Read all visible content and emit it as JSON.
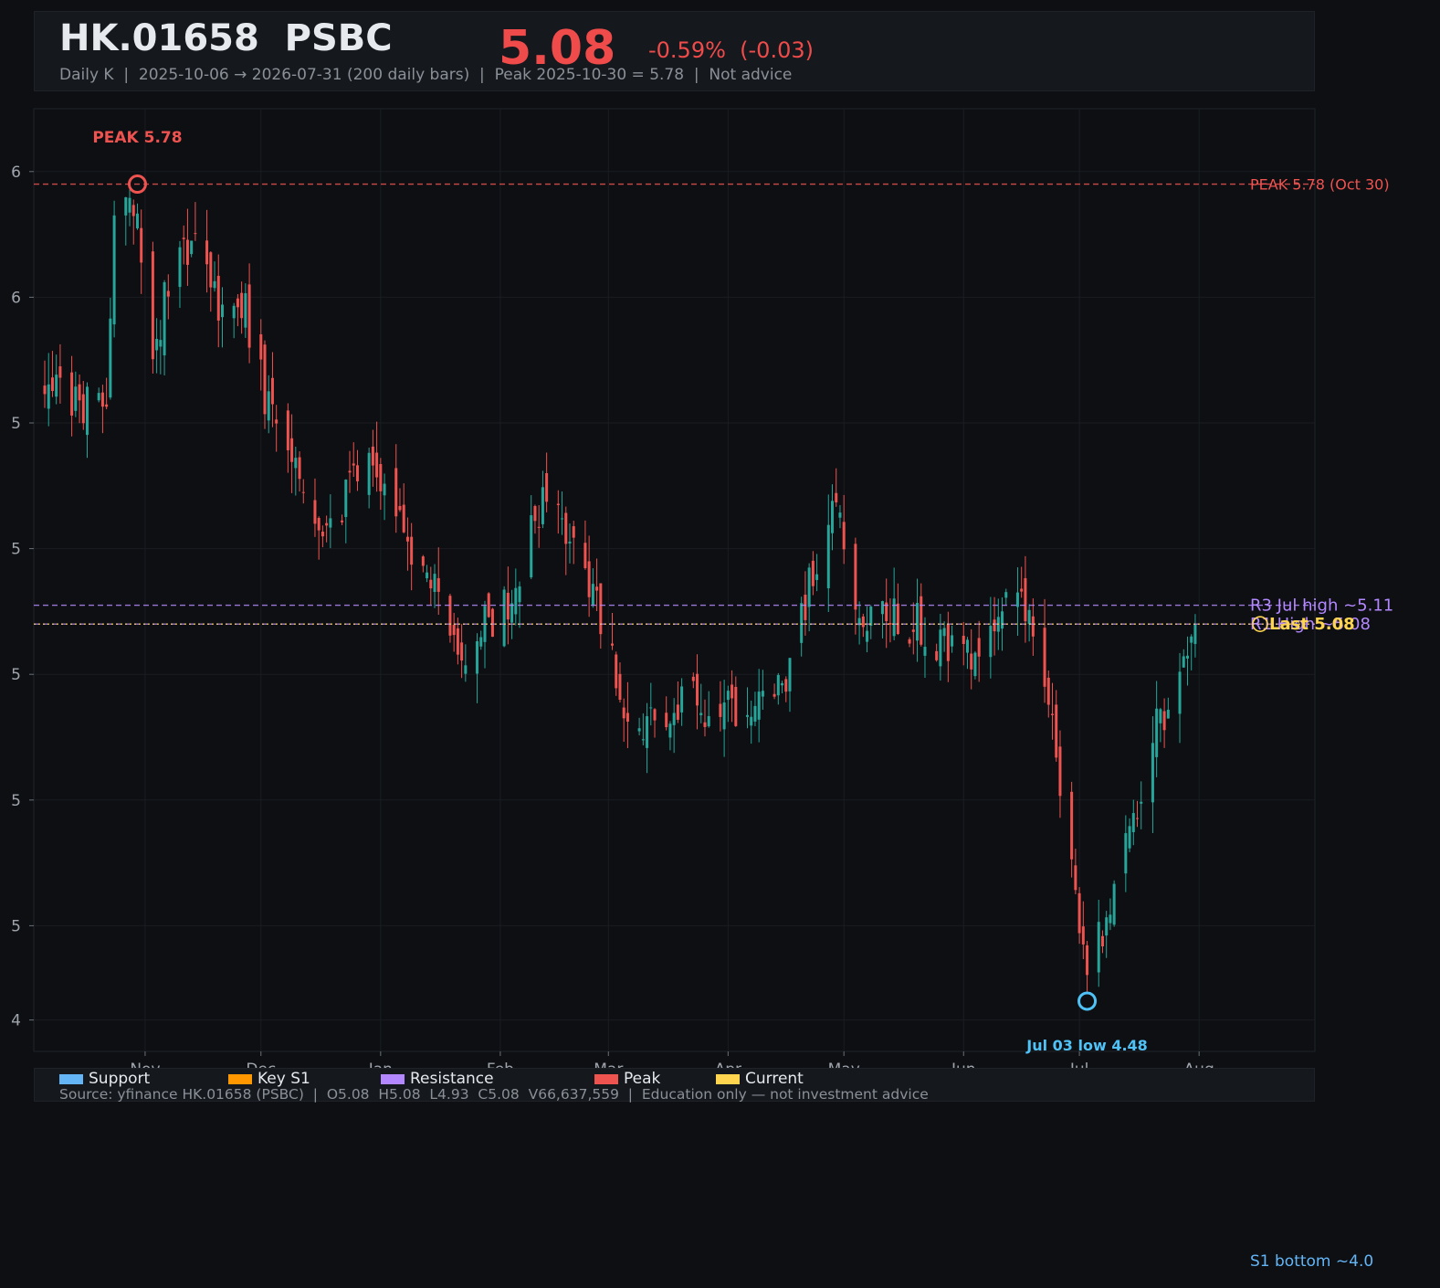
{
  "header": {
    "ticker": "HK.01658  PSBC",
    "price": "5.08",
    "change": "-0.59%  (-0.03)",
    "subtitle": "Daily K  |  2025-10-06 → 2026-07-31 (200 daily bars)  |  Peak 2025-10-30 = 5.78  |  Not advice"
  },
  "colors": {
    "up": "#26a69a",
    "down": "#ef5350",
    "support": "#64b5f6",
    "key_s1": "#ff9800",
    "resistance": "#b388ff",
    "peak": "#ef5350",
    "current": "#ffd54f"
  },
  "legend": {
    "items": [
      {
        "label": "Support",
        "color": "#64b5f6"
      },
      {
        "label": "Key S1",
        "color": "#ff9800"
      },
      {
        "label": "Resistance",
        "color": "#b388ff"
      },
      {
        "label": "Peak",
        "color": "#ef5350"
      },
      {
        "label": "Current",
        "color": "#ffd54f"
      }
    ],
    "source": "Source: yfinance HK.01658 (PSBC)  |  O5.08  H5.08  L4.93  C5.08  V66,637,559  |  Education only — not investment advice"
  },
  "chart_data": {
    "type": "candlestick",
    "x_range": [
      "2025-10-06",
      "2026-08-31"
    ],
    "ylim": [
      4.4,
      5.9
    ],
    "y_ticks": [
      {
        "value": 4.45,
        "label": "4"
      },
      {
        "value": 4.6,
        "label": "5"
      },
      {
        "value": 4.8,
        "label": "5"
      },
      {
        "value": 5.0,
        "label": "5"
      },
      {
        "value": 5.2,
        "label": "5"
      },
      {
        "value": 5.4,
        "label": "5"
      },
      {
        "value": 5.6,
        "label": "6"
      },
      {
        "value": 5.8,
        "label": "6"
      }
    ],
    "x_ticks": [
      {
        "date": "2025-11-01",
        "label": "Nov"
      },
      {
        "date": "2025-12-01",
        "label": "Dec"
      },
      {
        "date": "2026-01-01",
        "label": "Jan"
      },
      {
        "date": "2026-02-01",
        "label": "Feb"
      },
      {
        "date": "2026-03-01",
        "label": "Mar"
      },
      {
        "date": "2026-04-01",
        "label": "Apr"
      },
      {
        "date": "2026-05-01",
        "label": "May"
      },
      {
        "date": "2026-06-01",
        "label": "Jun"
      },
      {
        "date": "2026-07-01",
        "label": "Jul"
      },
      {
        "date": "2026-08-01",
        "label": "Aug"
      }
    ],
    "grid": true,
    "levels": [
      {
        "name": "peak",
        "value": 5.78,
        "label": "PEAK 5.78 (Oct 30)",
        "color": "#ef5350",
        "style": "dashed"
      },
      {
        "name": "r3",
        "value": 5.11,
        "label": "R3 Jul high ~5.11",
        "color": "#b388ff",
        "style": "dashed"
      },
      {
        "name": "r-high",
        "value": 5.08,
        "label": "R1 High ~5.08",
        "color": "#b388ff",
        "style": "dashed"
      },
      {
        "name": "last",
        "value": 5.08,
        "label": "Last 5.08",
        "color": "#ffd54f",
        "style": "dotted"
      },
      {
        "name": "s1-bottom",
        "value": 4.0,
        "label": "S1 bottom ~4.0",
        "color": "#64b5f6",
        "style": "none"
      }
    ],
    "annotations": [
      {
        "name": "peak",
        "date": "2025-10-30",
        "value": 5.78,
        "label": "PEAK 5.78",
        "color": "#ef5350"
      },
      {
        "name": "low",
        "date": "2026-07-03",
        "value": 4.48,
        "label": "Jul 03 low 4.48",
        "color": "#4fc3f7"
      }
    ],
    "anchors": [
      {
        "date": "2025-10-06",
        "close": 5.48
      },
      {
        "date": "2025-10-15",
        "close": 5.42
      },
      {
        "date": "2025-10-22",
        "close": 5.45
      },
      {
        "date": "2025-10-24",
        "close": 5.72
      },
      {
        "date": "2025-10-30",
        "close": 5.74
      },
      {
        "date": "2025-11-03",
        "close": 5.5
      },
      {
        "date": "2025-11-07",
        "close": 5.62
      },
      {
        "date": "2025-11-13",
        "close": 5.69
      },
      {
        "date": "2025-11-20",
        "close": 5.58
      },
      {
        "date": "2025-11-26",
        "close": 5.6
      },
      {
        "date": "2025-12-03",
        "close": 5.42
      },
      {
        "date": "2025-12-10",
        "close": 5.33
      },
      {
        "date": "2025-12-17",
        "close": 5.22
      },
      {
        "date": "2025-12-29",
        "close": 5.35
      },
      {
        "date": "2026-01-08",
        "close": 5.22
      },
      {
        "date": "2026-01-22",
        "close": 5.03
      },
      {
        "date": "2026-02-03",
        "close": 5.12
      },
      {
        "date": "2026-02-12",
        "close": 5.28
      },
      {
        "date": "2026-02-25",
        "close": 5.14
      },
      {
        "date": "2026-03-06",
        "close": 4.92
      },
      {
        "date": "2026-03-20",
        "close": 4.96
      },
      {
        "date": "2026-04-01",
        "close": 4.94
      },
      {
        "date": "2026-04-15",
        "close": 4.98
      },
      {
        "date": "2026-04-28",
        "close": 5.28
      },
      {
        "date": "2026-05-05",
        "close": 5.1
      },
      {
        "date": "2026-05-20",
        "close": 5.08
      },
      {
        "date": "2026-06-01",
        "close": 5.02
      },
      {
        "date": "2026-06-15",
        "close": 5.12
      },
      {
        "date": "2026-06-22",
        "close": 5.0
      },
      {
        "date": "2026-06-26",
        "close": 4.82
      },
      {
        "date": "2026-07-03",
        "close": 4.52
      },
      {
        "date": "2026-07-10",
        "close": 4.65
      },
      {
        "date": "2026-07-20",
        "close": 4.9
      },
      {
        "date": "2026-07-27",
        "close": 4.98
      },
      {
        "date": "2026-07-31",
        "close": 5.08
      }
    ]
  }
}
